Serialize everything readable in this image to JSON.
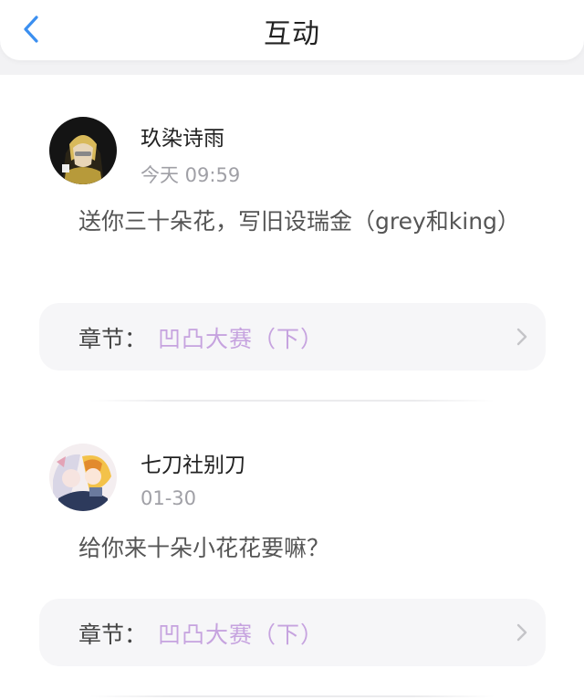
{
  "header": {
    "title": "互动",
    "back_icon": "chevron-left-icon",
    "accent_color": "#3b8ff0"
  },
  "comments": [
    {
      "username": "玖染诗雨",
      "time": "今天 09:59",
      "text": "送你三十朵花，写旧设瑞金（grey和king）",
      "chapter_label": "章节：",
      "chapter_title": "凹凸大赛（下）"
    },
    {
      "username": "七刀社别刀",
      "time": "01-30",
      "text": "给你来十朵小花花要嘛？",
      "chapter_label": "章节：",
      "chapter_title": "凹凸大赛（下）"
    }
  ],
  "colors": {
    "chapter_title": "#c6a3df",
    "secondary_text": "#a0a0a6"
  }
}
